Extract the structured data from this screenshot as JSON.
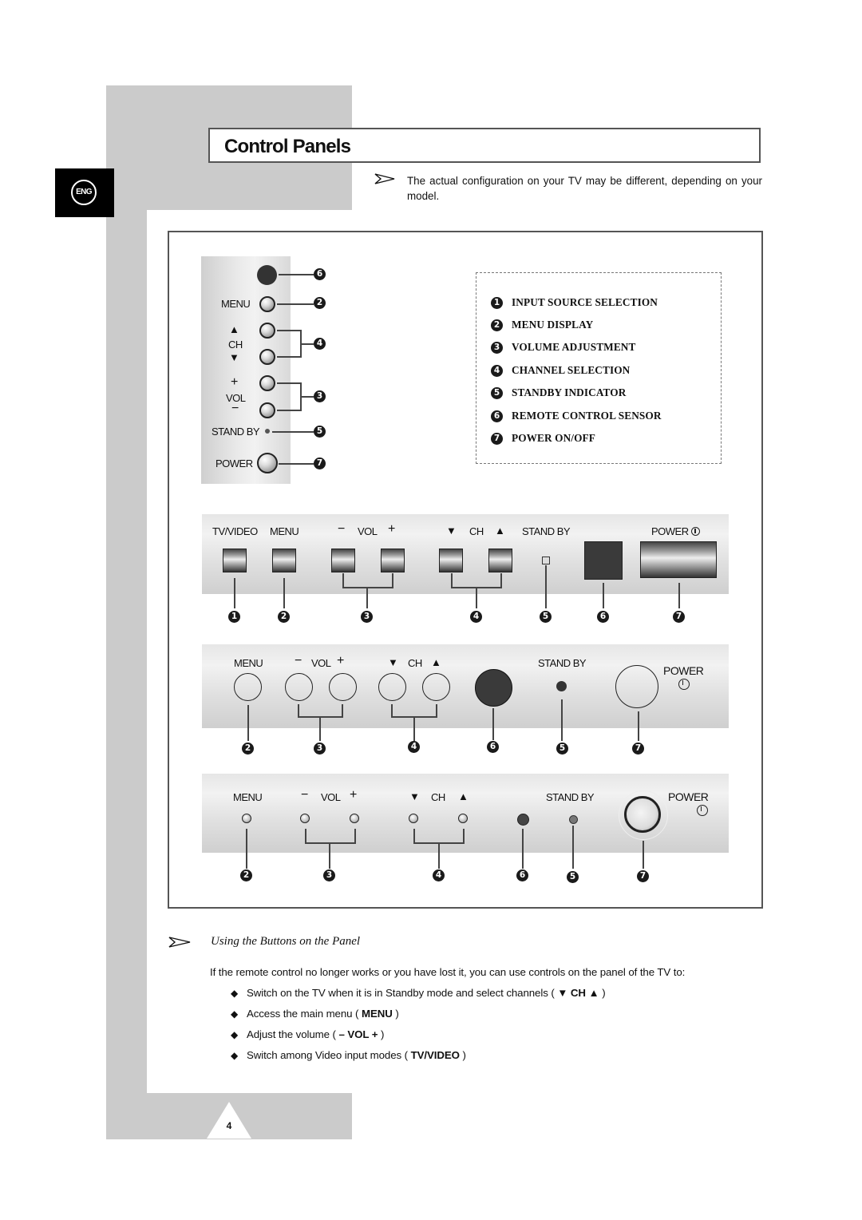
{
  "page": {
    "title": "Control Panels",
    "language_badge": "ENG",
    "page_number": "4"
  },
  "note": {
    "icon": "arrow-pointer-icon",
    "text": "The actual configuration on your TV may be different, depending on your model."
  },
  "legend": [
    {
      "num": "1",
      "label": "INPUT SOURCE SELECTION"
    },
    {
      "num": "2",
      "label": "MENU DISPLAY"
    },
    {
      "num": "3",
      "label": "VOLUME ADJUSTMENT"
    },
    {
      "num": "4",
      "label": "CHANNEL SELECTION"
    },
    {
      "num": "5",
      "label": "STANDBY INDICATOR"
    },
    {
      "num": "6",
      "label": "REMOTE CONTROL SENSOR"
    },
    {
      "num": "7",
      "label": "POWER ON/OFF"
    }
  ],
  "vertical_panel": {
    "labels": {
      "menu": "MENU",
      "ch": "CH",
      "vol": "VOL",
      "plus": "+",
      "minus": "−",
      "standby": "STAND BY",
      "power": "POWER",
      "up": "▲",
      "down": "▼"
    },
    "callouts": [
      "6",
      "2",
      "4",
      "3",
      "5",
      "7"
    ]
  },
  "panel_a": {
    "labels": {
      "tvvideo": "TV/VIDEO",
      "menu": "MENU",
      "vol": "VOL",
      "minus": "−",
      "plus": "+",
      "ch": "CH",
      "down": "▼",
      "up": "▲",
      "standby": "STAND BY",
      "power": "POWER"
    },
    "callouts": [
      "1",
      "2",
      "3",
      "4",
      "5",
      "6",
      "7"
    ]
  },
  "panel_b": {
    "labels": {
      "menu": "MENU",
      "vol": "VOL",
      "minus": "−",
      "plus": "+",
      "ch": "CH",
      "down": "▼",
      "up": "▲",
      "standby": "STAND BY",
      "power": "POWER"
    },
    "callouts": [
      "2",
      "3",
      "4",
      "6",
      "5",
      "7"
    ]
  },
  "panel_c": {
    "labels": {
      "menu": "MENU",
      "vol": "VOL",
      "minus": "−",
      "plus": "+",
      "ch": "CH",
      "down": "▼",
      "up": "▲",
      "standby": "STAND BY",
      "power": "POWER"
    },
    "callouts": [
      "2",
      "3",
      "4",
      "6",
      "5",
      "7"
    ]
  },
  "section": {
    "title": "Using the Buttons on the Panel",
    "intro": "If the remote control no longer works or you have lost it, you can use controls on the panel of the TV to:",
    "bullets": [
      {
        "text": "Switch on the TV when it is in Standby mode and select channels ( ",
        "bold": "▼ CH ▲",
        "end": " )"
      },
      {
        "text": "Access the main menu ( ",
        "bold": "MENU",
        "end": " )"
      },
      {
        "text": "Adjust the volume ( ",
        "bold": "– VOL +",
        "end": " )"
      },
      {
        "text": "Switch among Video input modes ( ",
        "bold": "TV/VIDEO",
        "end": " )"
      }
    ],
    "bullet_glyph": "◆"
  }
}
